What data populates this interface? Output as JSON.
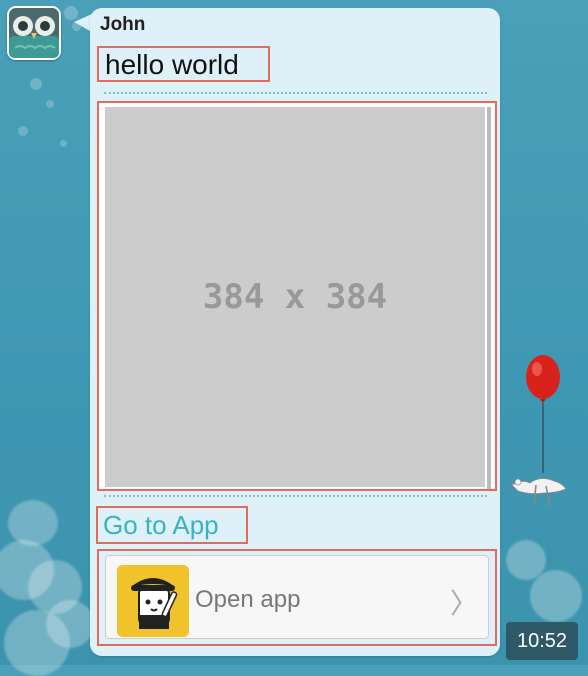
{
  "chat": {
    "sender": "John",
    "text_message": "hello world",
    "image_placeholder": "384 x 384",
    "link_text": "Go to App",
    "app_card_label": "Open app",
    "chevron": "〉"
  },
  "status": {
    "time": "10:52"
  },
  "colors": {
    "link": "#39b3c0",
    "highlight": "#e06b5e",
    "card_bg": "#dff1f8",
    "bg": "#4aa0b8"
  },
  "icons": [
    "owl-avatar-icon",
    "app-mascot-icon",
    "chevron-right-icon",
    "balloon-goose-icon"
  ]
}
